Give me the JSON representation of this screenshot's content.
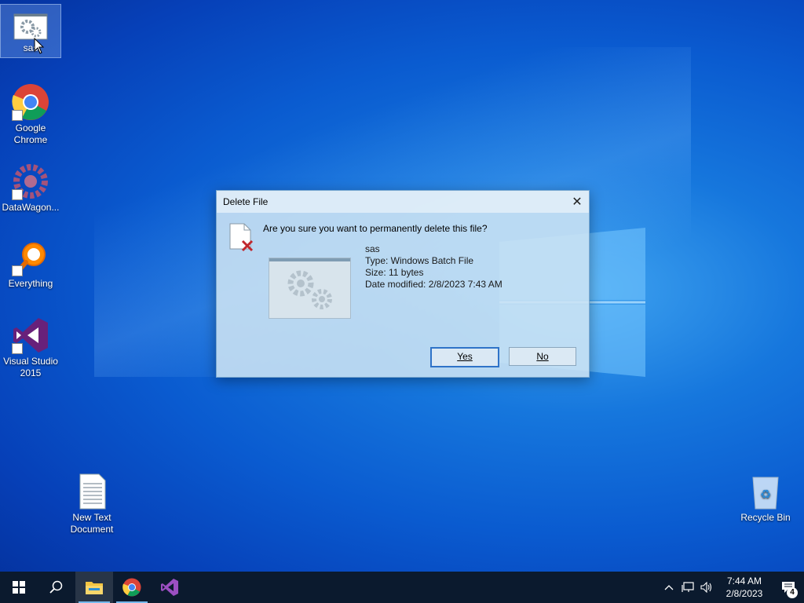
{
  "desktop": {
    "icons": [
      {
        "label": "sas",
        "icon": "batch-file-icon"
      },
      {
        "label": "Google Chrome",
        "icon": "chrome-icon"
      },
      {
        "label": "DataWagon...",
        "icon": "datawagon-icon"
      },
      {
        "label": "Everything",
        "icon": "everything-search-icon"
      },
      {
        "label": "Visual Studio 2015",
        "icon": "visual-studio-icon"
      },
      {
        "label": "New Text Document",
        "icon": "text-document-icon"
      },
      {
        "label": "Recycle Bin",
        "icon": "recycle-bin-icon"
      }
    ]
  },
  "dialog": {
    "title": "Delete File",
    "close_glyph": "✕",
    "question": "Are you sure you want to permanently delete this file?",
    "file": {
      "name": "sas",
      "type": "Type: Windows Batch File",
      "size": "Size: 11 bytes",
      "modified": "Date modified: 2/8/2023 7:43 AM"
    },
    "yes_label": "Yes",
    "no_label": "No"
  },
  "taskbar": {
    "items": [
      "start-icon",
      "search-icon",
      "file-explorer-icon",
      "chrome-icon",
      "visual-studio-icon"
    ],
    "clock_time": "7:44 AM",
    "clock_date": "2/8/2023",
    "notification_count": "4"
  }
}
